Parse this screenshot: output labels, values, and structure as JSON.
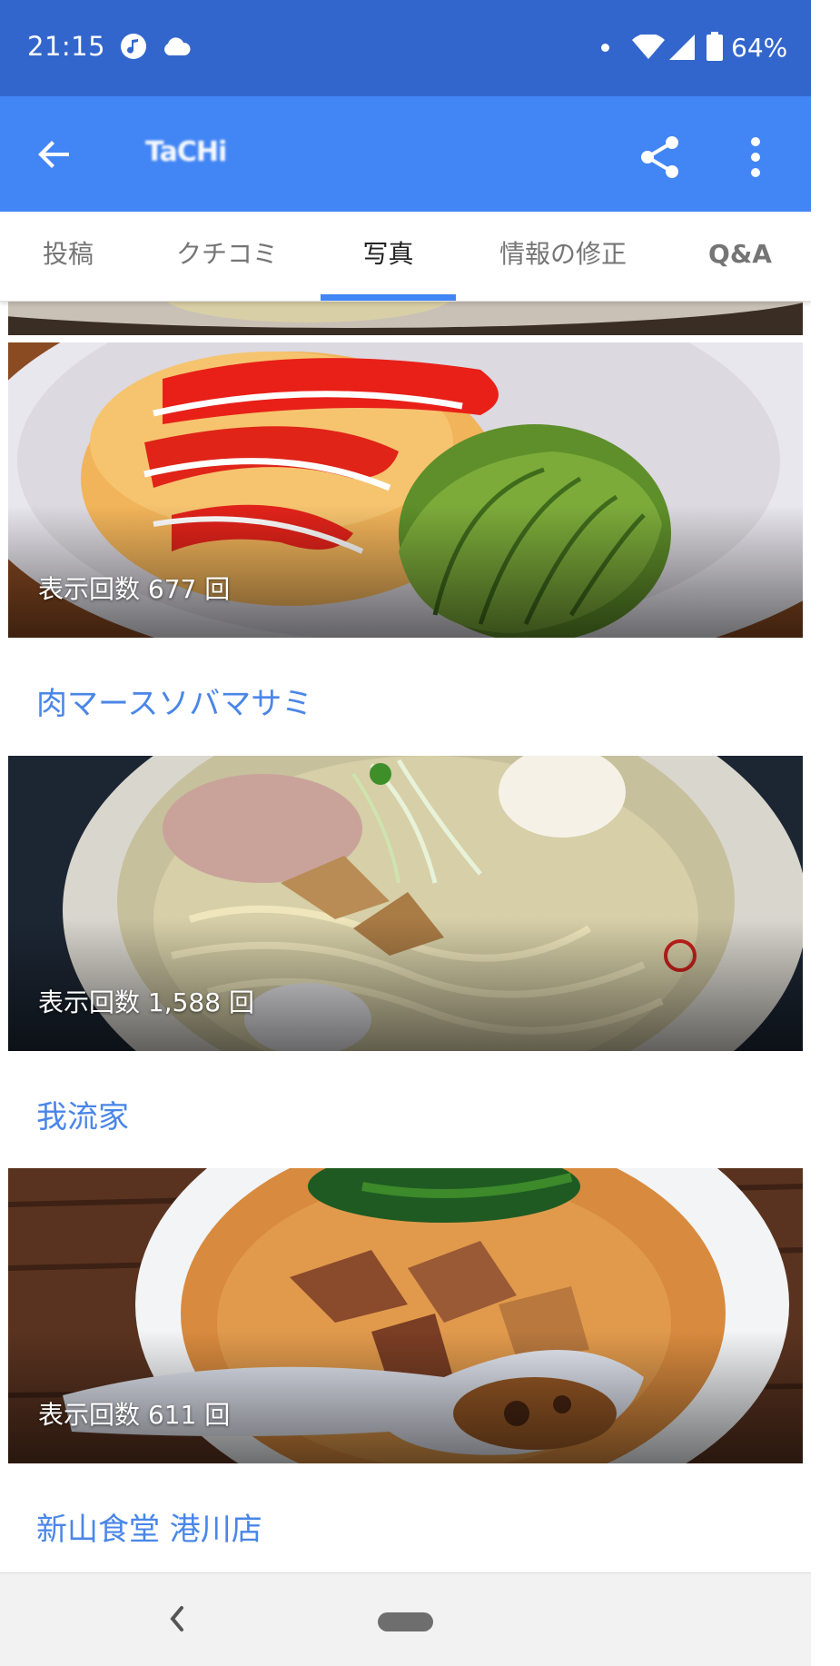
{
  "status_bar": {
    "time": "21:15",
    "battery": "64%",
    "icons": [
      "music-icon",
      "cloud-icon",
      "notification-dot",
      "wifi-icon",
      "signal-icon",
      "battery-icon"
    ]
  },
  "app_bar": {
    "title": "TaCHi",
    "back_icon": "arrow-back-icon",
    "share_icon": "share-icon",
    "more_icon": "more-vert-icon",
    "color": "#4285f4"
  },
  "tabs": [
    {
      "label": "投稿"
    },
    {
      "label": "クチコミ"
    },
    {
      "label": "写真",
      "active": true
    },
    {
      "label": "情報の修正"
    },
    {
      "label": "Q&A"
    }
  ],
  "feed": {
    "items": [
      {
        "views": "表示回数 677 回",
        "place": "肉マースソバマサミ"
      },
      {
        "views": "表示回数 1,588 回",
        "place": "我流家"
      },
      {
        "views": "表示回数 611 回",
        "place": "新山食堂 港川店"
      }
    ]
  },
  "nav_bar": {
    "back_icon": "nav-back-icon",
    "home_icon": "home-pill-icon"
  },
  "colors": {
    "status_bar": "#3366cc",
    "app_bar": "#4285f4",
    "accent": "#4285f4",
    "place_link": "#4a86e8"
  }
}
